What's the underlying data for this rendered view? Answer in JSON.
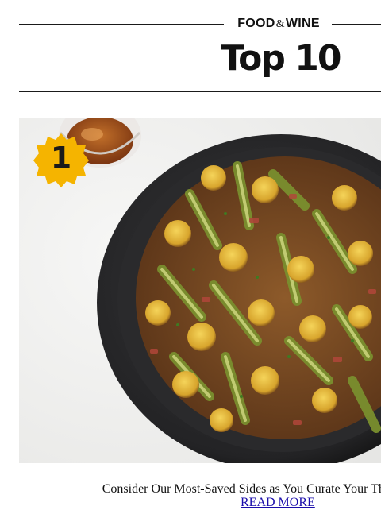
{
  "header": {
    "brand_left": "FOOD",
    "brand_amp": "&",
    "brand_right": "WINE",
    "title": "Top 10"
  },
  "hero": {
    "rank_badge": "1",
    "badge_color": "#f5b400",
    "image_subject": "leek and potato tart on dark round platter with glass of amber drink"
  },
  "story": {
    "headline": "Consider Our Most-Saved Sides as You Curate Your Tha",
    "link_label": "READ MORE",
    "link_color": "#1a0dab"
  }
}
